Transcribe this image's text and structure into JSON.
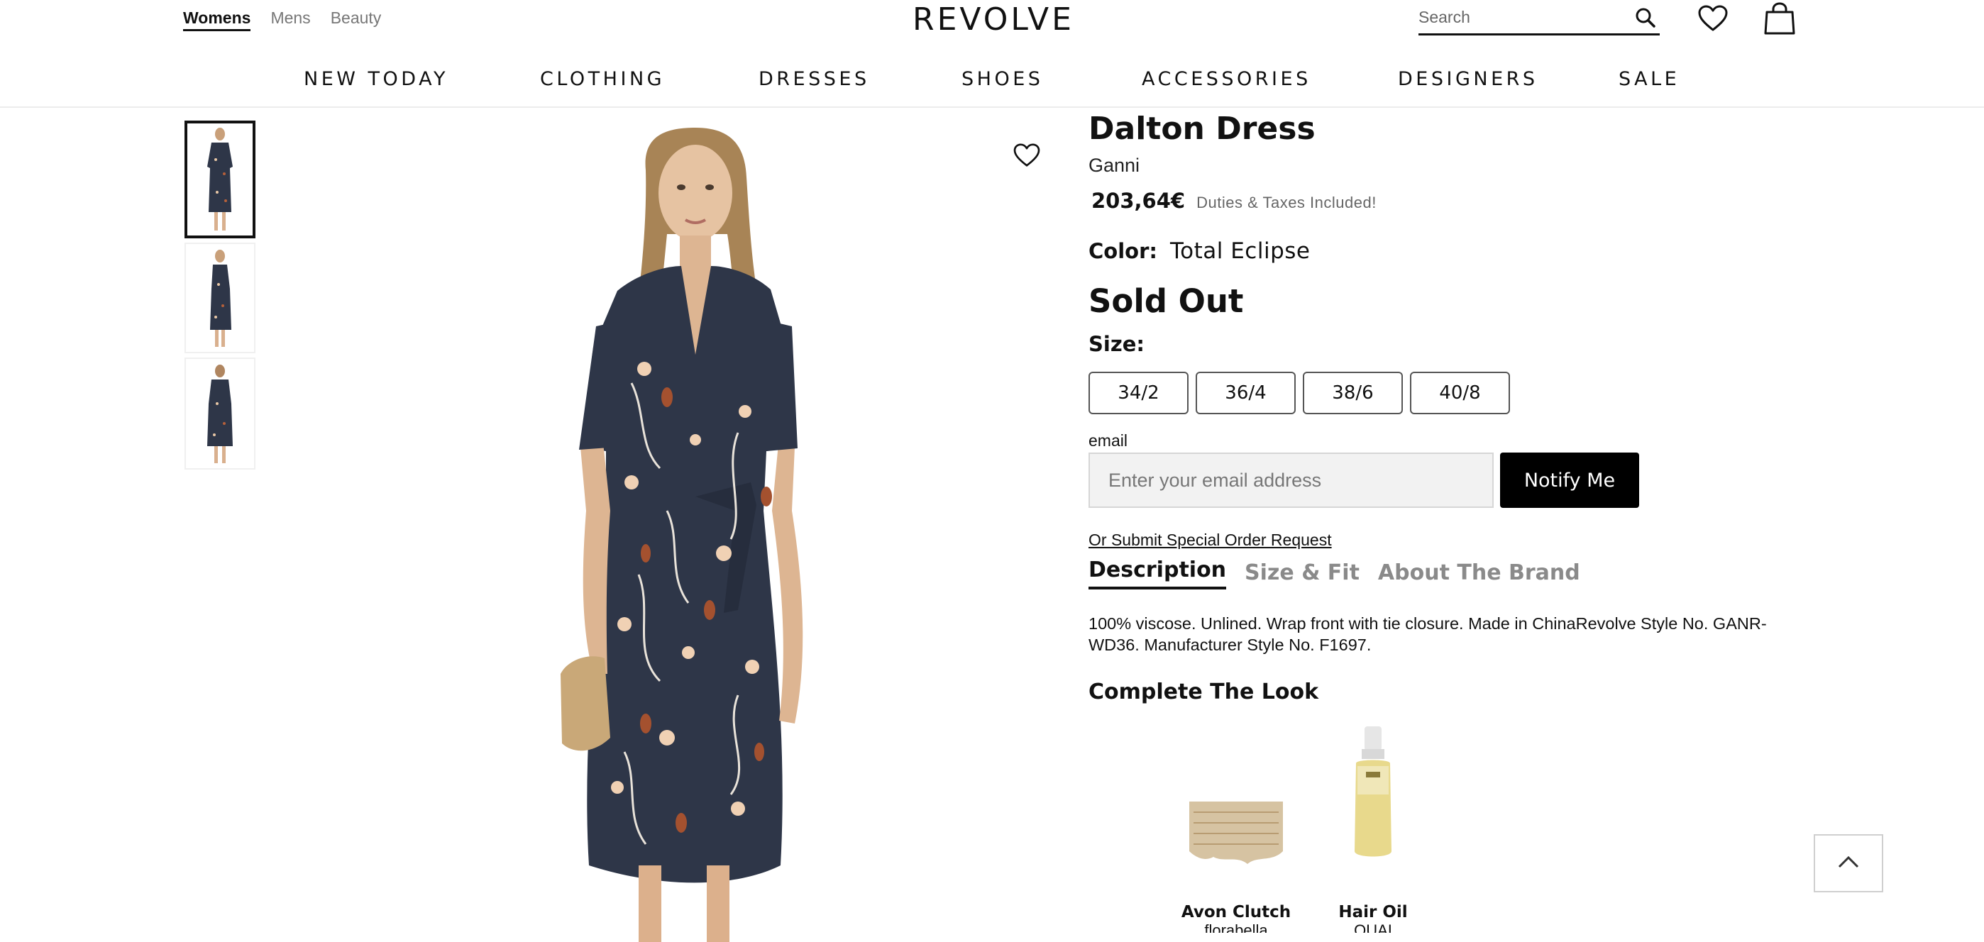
{
  "header": {
    "gender_links": [
      {
        "label": "Womens",
        "active": true
      },
      {
        "label": "Mens",
        "active": false
      },
      {
        "label": "Beauty",
        "active": false
      }
    ],
    "logo": "REVOLVE",
    "search": {
      "placeholder": "Search",
      "value": ""
    },
    "icons": [
      "search-icon",
      "heart-icon",
      "shopping-bag-icon"
    ]
  },
  "nav": {
    "items": [
      "NEW TODAY",
      "CLOTHING",
      "DRESSES",
      "SHOES",
      "ACCESSORIES",
      "DESIGNERS",
      "SALE"
    ]
  },
  "gallery": {
    "thumbnails_count": 3,
    "active_thumbnail": 1
  },
  "product": {
    "name": "Dalton Dress",
    "brand": "Ganni",
    "price": "203,64€",
    "duty_note": "Duties & Taxes Included!",
    "color_label": "Color:",
    "color_value": "Total Eclipse",
    "availability": "Sold Out",
    "size_label": "Size:",
    "sizes": [
      "34/2",
      "36/4",
      "38/6",
      "40/8"
    ],
    "email_label": "email",
    "email_placeholder": "Enter your email address",
    "notify_label": "Notify Me",
    "special_order": "Or Submit Special Order Request",
    "tabs": [
      {
        "label": "Description",
        "active": true
      },
      {
        "label": "Size & Fit",
        "active": false
      },
      {
        "label": "About The Brand",
        "active": false
      }
    ],
    "description": "100% viscose. Unlined. Wrap front with tie closure. Made in ChinaRevolve Style No. GANR-WD36. Manufacturer Style No. F1697."
  },
  "complete_the_look": {
    "title": "Complete The Look",
    "items": [
      {
        "name": "Avon Clutch",
        "sub": "florabella"
      },
      {
        "name": "Hair Oil",
        "sub": "OUAI"
      }
    ]
  },
  "colors": {
    "accent": "#111111",
    "dress": "#2e3648",
    "notify_bg": "#000000"
  }
}
